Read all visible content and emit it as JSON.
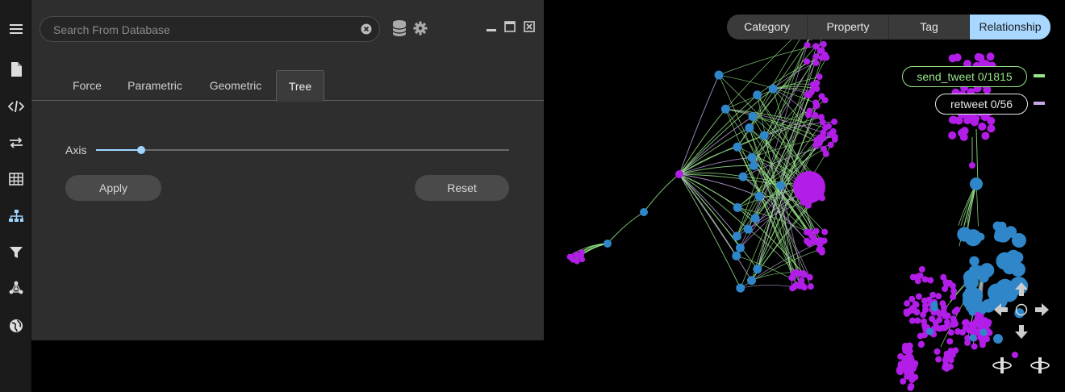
{
  "rail": {
    "items": [
      {
        "name": "menu-icon"
      },
      {
        "name": "file-icon"
      },
      {
        "name": "code-icon"
      },
      {
        "name": "swap-icon"
      },
      {
        "name": "table-icon"
      },
      {
        "name": "hierarchy-icon"
      },
      {
        "name": "filter-icon"
      },
      {
        "name": "network-icon"
      },
      {
        "name": "globe-icon"
      }
    ]
  },
  "search": {
    "placeholder": "Search From Database",
    "value": ""
  },
  "panel": {
    "tabs": [
      {
        "label": "Force"
      },
      {
        "label": "Parametric"
      },
      {
        "label": "Geometric"
      },
      {
        "label": "Tree",
        "active": true
      }
    ],
    "axis_label": "Axis",
    "axis_slider_fraction": 0.11,
    "apply_label": "Apply",
    "reset_label": "Reset"
  },
  "view_modes": {
    "items": [
      {
        "label": "Category"
      },
      {
        "label": "Property"
      },
      {
        "label": "Tag"
      },
      {
        "label": "Relationship",
        "active": true
      }
    ]
  },
  "legend": [
    {
      "label": "send_tweet 0/1815",
      "color": "#98e68a"
    },
    {
      "label": "retweet 0/56",
      "color": "#c8a6e8"
    }
  ],
  "colors": {
    "accent": "#a8d8ff",
    "node_blue": "#2f86c8",
    "node_purple": "#b21de8",
    "edge_green": "#98e68a",
    "edge_lavender": "#c8a6e8"
  }
}
